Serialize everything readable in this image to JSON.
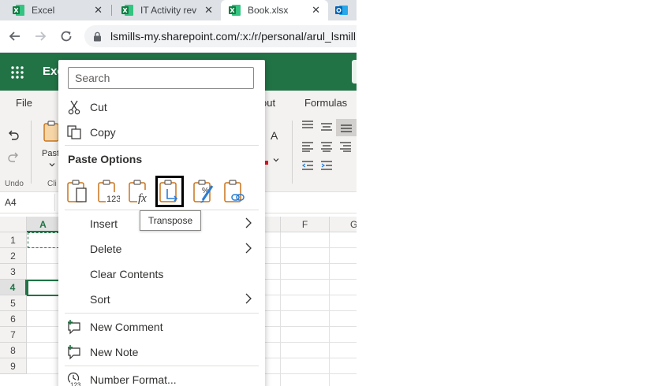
{
  "browser": {
    "tabs": [
      {
        "label": "Excel",
        "close": "✕"
      },
      {
        "label": "IT Activity rev",
        "close": "✕"
      },
      {
        "label": "Book.xlsx",
        "close": "✕",
        "active": true
      },
      {
        "label": "",
        "close": ""
      }
    ],
    "url": "lsmills-my.sharepoint.com/:x:/r/personal/arul_lsmill"
  },
  "app": {
    "name": "Exc"
  },
  "ribbon": {
    "tabs": [
      "File",
      "out",
      "Formulas"
    ],
    "paste_label": "Past",
    "clipboard_label": "Cli",
    "undo_label": "Undo",
    "font_grow": "A"
  },
  "namebox": {
    "value": "A4"
  },
  "grid": {
    "columns": [
      {
        "label": "A"
      },
      {
        "label": "F"
      },
      {
        "label": "G"
      }
    ],
    "rows": [
      "1",
      "2",
      "3",
      "4",
      "5",
      "6",
      "7",
      "8",
      "9"
    ]
  },
  "context_menu": {
    "search_placeholder": "Search",
    "cut": "Cut",
    "copy": "Copy",
    "paste_options_heading": "Paste Options",
    "paste_icons": [
      {
        "name": "paste-icon"
      },
      {
        "name": "paste-values-icon",
        "glyph": "123"
      },
      {
        "name": "paste-formulas-icon",
        "glyph": "fx"
      },
      {
        "name": "paste-transpose-icon",
        "highlighted": true
      },
      {
        "name": "paste-formatting-icon",
        "glyph": "%"
      },
      {
        "name": "paste-link-icon"
      }
    ],
    "tooltip": "Transpose",
    "insert": "Insert",
    "delete": "Delete",
    "clear_contents": "Clear Contents",
    "sort": "Sort",
    "new_comment": "New Comment",
    "new_note": "New Note",
    "number_format": "Number Format...",
    "number_format_glyph": "123"
  },
  "colors": {
    "excel_green": "#217346",
    "clipboard_orange": "#c9741a",
    "accent_blue": "#2b7cd3"
  }
}
